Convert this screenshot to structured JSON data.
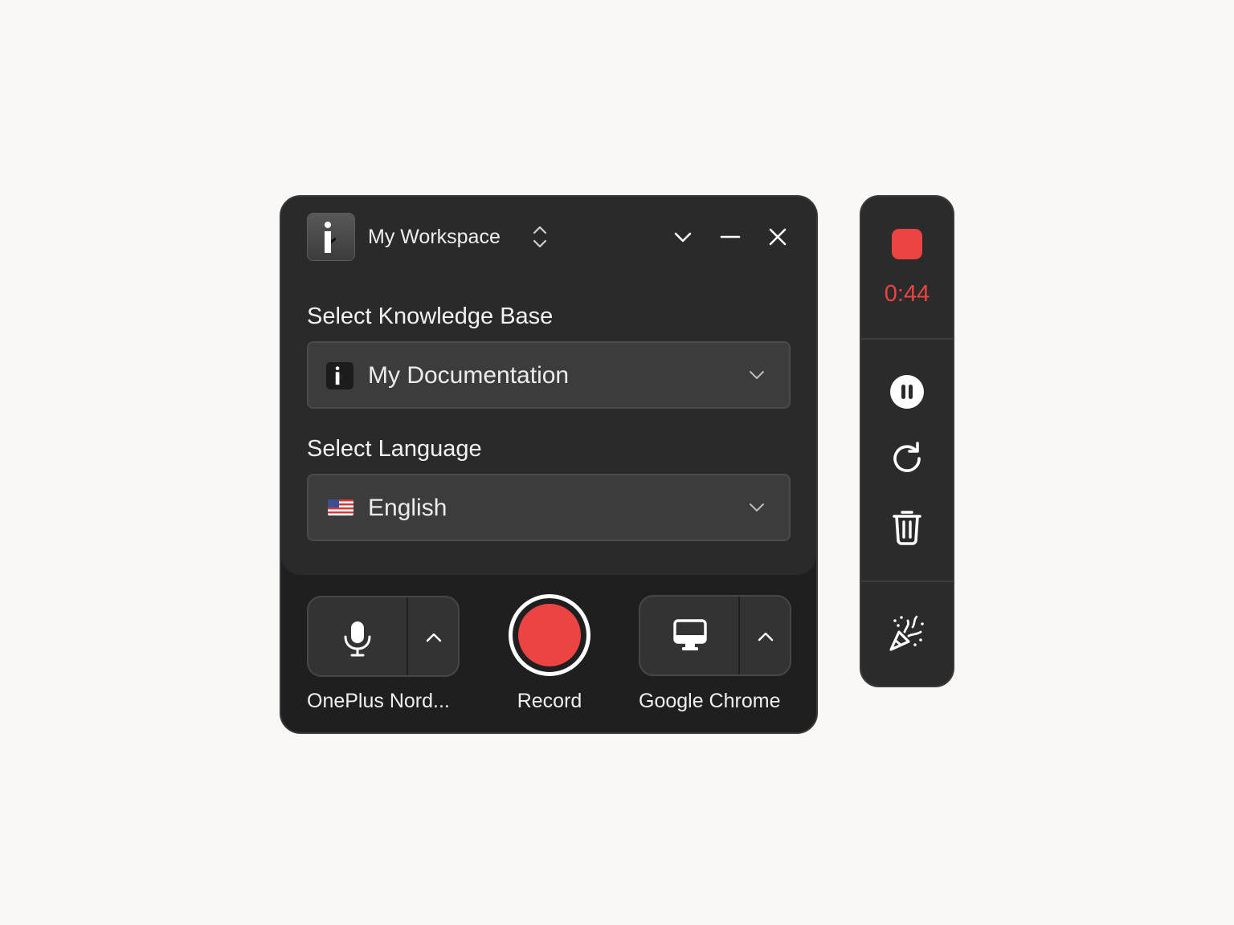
{
  "workspace": {
    "name": "My Workspace"
  },
  "knowledge_base": {
    "label": "Select Knowledge Base",
    "value": "My Documentation"
  },
  "language": {
    "label": "Select Language",
    "value": "English",
    "flag": "us-flag-icon"
  },
  "controls": {
    "microphone_label": "OnePlus Nord...",
    "record_label": "Record",
    "screen_label": "Google Chrome"
  },
  "recording_bar": {
    "timer": "0:44"
  },
  "colors": {
    "accent_red": "#ec4343",
    "panel_bg": "#2a2a2a",
    "panel_footer_bg": "#1f1f1f",
    "page_bg": "#f9f8f6"
  },
  "icons": {
    "logo": "brand-logo-icon",
    "switch": "up-down-chevron-icon",
    "collapse": "chevron-down-icon",
    "minimize": "minimize-icon",
    "close": "close-icon",
    "microphone": "microphone-icon",
    "screen": "monitor-icon",
    "expand": "chevron-up-icon",
    "stop": "stop-icon",
    "pause": "pause-icon",
    "restart": "restart-icon",
    "delete": "trash-icon",
    "finish": "party-popper-icon"
  }
}
